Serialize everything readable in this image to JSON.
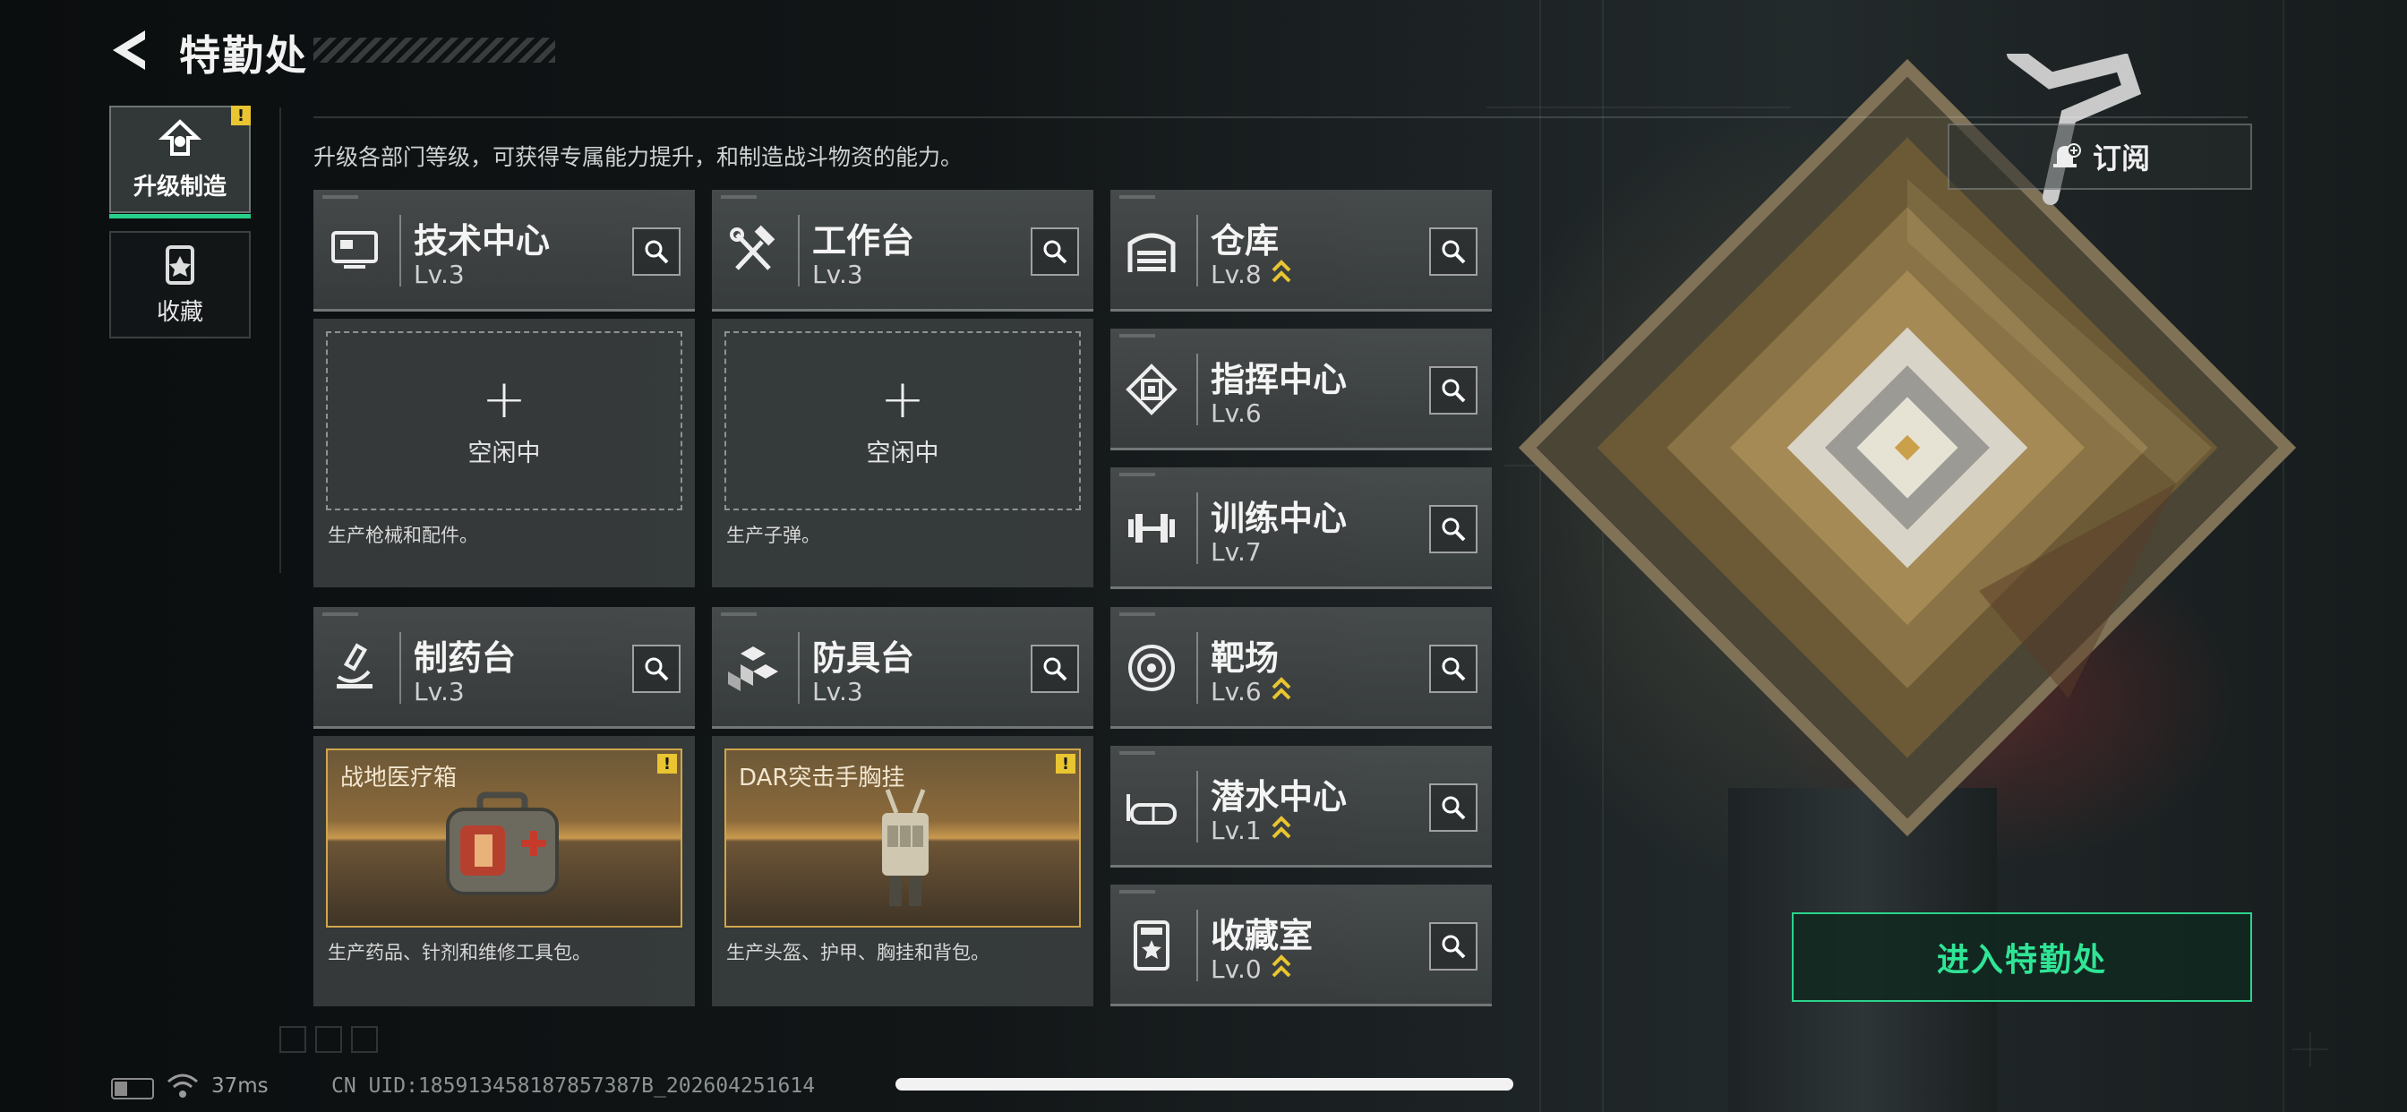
{
  "header": {
    "title": "特勤处"
  },
  "tabs": [
    {
      "label": "升级制造",
      "active": true,
      "icon": "upgrade-icon",
      "warn": "!"
    },
    {
      "label": "收藏",
      "active": false,
      "icon": "collection-icon"
    }
  ],
  "description": "升级各部门等级，可获得专属能力提升，和制造战斗物资的能力。",
  "departments": {
    "tech_center": {
      "name": "技术中心",
      "level": "Lv.3",
      "icon": "monitor-icon"
    },
    "workbench": {
      "name": "工作台",
      "level": "Lv.3",
      "icon": "tools-icon"
    },
    "warehouse": {
      "name": "仓库",
      "level": "Lv.8",
      "icon": "garage-icon",
      "upgradable": true
    },
    "command_center": {
      "name": "指挥中心",
      "level": "Lv.6",
      "icon": "chip-icon"
    },
    "training_center": {
      "name": "训练中心",
      "level": "Lv.7",
      "icon": "dumbbell-icon"
    },
    "pharmacy": {
      "name": "制药台",
      "level": "Lv.3",
      "icon": "microscope-icon"
    },
    "armor_bench": {
      "name": "防具台",
      "level": "Lv.3",
      "icon": "blocks-icon"
    },
    "shooting_range": {
      "name": "靶场",
      "level": "Lv.6",
      "icon": "target-icon",
      "upgradable": true
    },
    "diving_center": {
      "name": "潜水中心",
      "level": "Lv.1",
      "icon": "goggles-icon",
      "upgradable": true
    },
    "collection_room": {
      "name": "收藏室",
      "level": "Lv.0",
      "icon": "trophy-icon",
      "upgradable": true
    }
  },
  "slots": {
    "tech_center": {
      "status": "空闲中",
      "note": "生产枪械和配件。"
    },
    "workbench": {
      "status": "空闲中",
      "note": "生产子弹。"
    },
    "pharmacy": {
      "item": "战地医疗箱",
      "note": "生产药品、针剂和维修工具包。",
      "warn": "!"
    },
    "armor_bench": {
      "item": "DAR突击手胸挂",
      "note": "生产头盔、护甲、胸挂和背包。",
      "warn": "!"
    }
  },
  "buttons": {
    "subscribe": "订阅",
    "enter": "进入特勤处"
  },
  "status_bar": {
    "ping": "37ms",
    "uid": "CN UID:185913458187857387B_202604251614"
  },
  "colors": {
    "accent": "#2ad38c",
    "upgrade": "#e8c531",
    "item_border": "#d1a64b"
  }
}
